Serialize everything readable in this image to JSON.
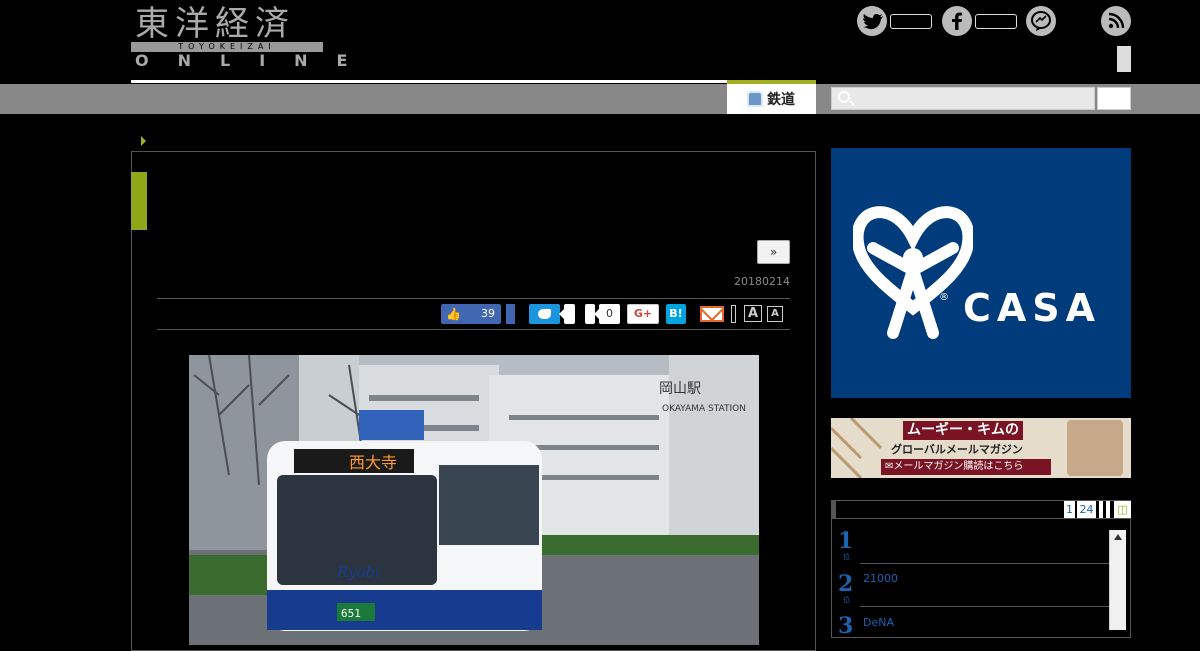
{
  "header": {
    "logo_jp": "東洋経済",
    "logo_roman": "TOYOKEIZAI",
    "logo_en": "ONLINE",
    "social_icons": [
      "twitter-icon",
      "facebook-icon",
      "messenger-icon",
      "rss-icon"
    ]
  },
  "nav": {
    "rail_label": "鉄道",
    "accent_color": "#a0b01e"
  },
  "article": {
    "next_label": "»",
    "date": "20180214",
    "share": {
      "facebook_like_count": "39",
      "pocket_count": "0",
      "google_plus_label": "G+",
      "hatena_label": "B!",
      "font_large_label": "A",
      "font_small_label": "A"
    },
    "photo": {
      "bus_destination": "西大寺",
      "bus_brand": "Ryobi",
      "bus_plate": "651",
      "station_name": "岡山駅",
      "station_roman": "OKAYAMA STATION"
    }
  },
  "sidebar": {
    "ad_casa_label": "CASA",
    "ad_casa_reg": "®",
    "ad_mugi_head": "ムーギー・キムの",
    "ad_mugi_sub": "グローバルメールマガジン",
    "ad_mugi_cta": "✉メールマガジン購読はこちら",
    "ranking": {
      "pages": [
        "1",
        "24"
      ],
      "items": [
        {
          "num": "1",
          "sub": "位",
          "text": ""
        },
        {
          "num": "2",
          "sub": "位",
          "text": "21000"
        },
        {
          "num": "3",
          "sub": "位",
          "text": "DeNA"
        }
      ]
    }
  }
}
